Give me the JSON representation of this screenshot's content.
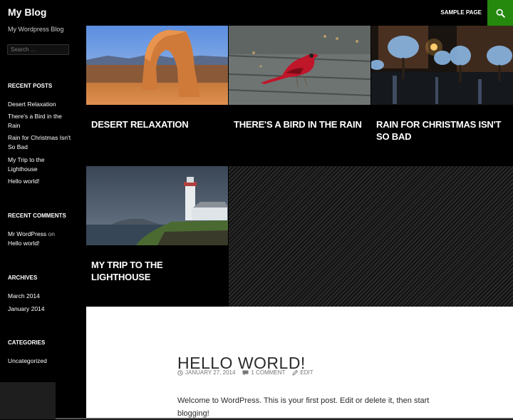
{
  "header": {
    "site_title": "My Blog",
    "nav": [
      {
        "label": "SAMPLE PAGE"
      }
    ],
    "search_icon": "search-icon",
    "accent_color": "#24890d"
  },
  "sidebar": {
    "tagline": "My Wordpress Blog",
    "search": {
      "placeholder": "Search …",
      "value": ""
    },
    "recent_posts": {
      "title": "RECENT POSTS",
      "items": [
        {
          "label": "Desert Relaxation"
        },
        {
          "label": "There's a Bird in the Rain"
        },
        {
          "label": "Rain for Christmas Isn't So Bad"
        },
        {
          "label": "My Trip to the Lighthouse"
        },
        {
          "label": "Hello world!"
        }
      ]
    },
    "recent_comments": {
      "title": "RECENT COMMENTS",
      "author": "Mr WordPress",
      "connector": "on",
      "post": "Hello world!"
    },
    "archives": {
      "title": "ARCHIVES",
      "items": [
        {
          "label": "March 2014"
        },
        {
          "label": "January 2014"
        }
      ]
    },
    "categories": {
      "title": "CATEGORIES",
      "items": [
        {
          "label": "Uncategorized"
        }
      ]
    }
  },
  "featured": [
    {
      "title": "DESERT RELAXATION",
      "image": "desert-arch"
    },
    {
      "title": "THERE'S A BIRD IN THE RAIN",
      "image": "cardinal-rain"
    },
    {
      "title": "RAIN FOR CHRISTMAS ISN'T SO BAD",
      "image": "night-plaza-lights"
    },
    {
      "title": "MY TRIP TO THE LIGHTHOUSE",
      "image": "lighthouse-coast"
    }
  ],
  "post": {
    "title": "HELLO WORLD!",
    "date": "JANUARY 27, 2014",
    "comments": "1 COMMENT",
    "edit": "EDIT",
    "content": "Welcome to WordPress. This is your first post. Edit or delete it, then start blogging!"
  }
}
